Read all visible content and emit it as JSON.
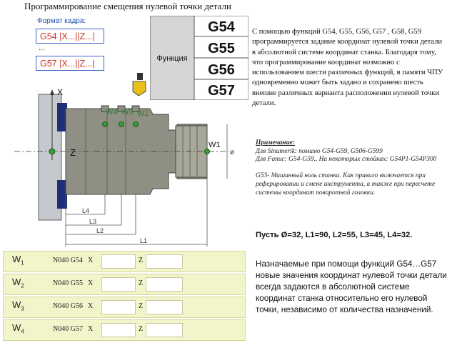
{
  "title": "Программирование смещения нулевой точки детали",
  "frame_format": {
    "label": "Формат кадра:",
    "first": "G54 |X...||Z...|",
    "ellipsis": "...",
    "last": "G57 |X...||Z...|"
  },
  "function_table": {
    "label": "Функция",
    "codes": [
      "G54",
      "G55",
      "G56",
      "G57"
    ]
  },
  "description": "С помощью функций G54, G55, G56, G57 , G58, G59 программируется задание координат нулевой точки детали в абсолютной системе координат станка. Благодаря тому, что программирование координат возможно с использованием шести различных функций, в памяти ЧПУ одновременно может быть задано и сохранено шесть внешне различных варианта расположения нулевой точки детали.",
  "note": {
    "title": "Примечание:",
    "line1": "Для Sinumerik: помимо G54-G59, G506-G599",
    "line2": "Для Fanuc: G54-G59., На некоторых стойках: G54P1-G54P300",
    "line3": "G53- Машинный ноль станка. Как правило включается при реферировании и смене инструмента, а также при пересчете системы координат поворотной головки."
  },
  "parameters": "Пусть Ø=32, L1=90, L2=55, L3=45, L4=32.",
  "assignment_text": "Назначаемые при помощи функций G54…G57 новые значения координат нулевой точки детали всегда задаются в абсолютной системе координат станка относительно его нулевой точки, независимо от количества назначений.",
  "drawing": {
    "axis_x": "X",
    "axis_z": "Z",
    "diameter": "ø",
    "w_labels": [
      "W4",
      "W3",
      "W2",
      "W1"
    ],
    "dims": [
      "L4",
      "L3",
      "L2",
      "L1"
    ]
  },
  "rows": [
    {
      "w": "W",
      "sub": "1",
      "code": "N040 G54",
      "x_label": "X",
      "z_label": "Z",
      "x_value": "",
      "z_value": ""
    },
    {
      "w": "W",
      "sub": "2",
      "code": "N040 G55",
      "x_label": "X",
      "z_label": "Z",
      "x_value": "",
      "z_value": ""
    },
    {
      "w": "W",
      "sub": "3",
      "code": "N040 G56",
      "x_label": "X",
      "z_label": "Z",
      "x_value": "",
      "z_value": ""
    },
    {
      "w": "W",
      "sub": "4",
      "code": "N040 G57",
      "x_label": "X",
      "z_label": "Z",
      "x_value": "",
      "z_value": ""
    }
  ],
  "colors": {
    "frame_border": "#3b63c8",
    "frame_text": "#c0392b",
    "row_bg": "#f2f4c9",
    "w_label": "#2e7d32",
    "part": "#8f8f83"
  }
}
